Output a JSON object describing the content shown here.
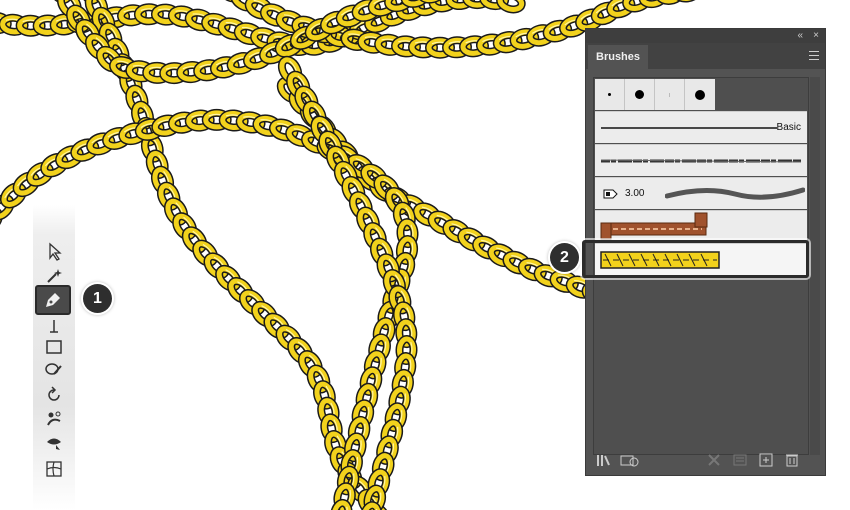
{
  "panel": {
    "tab_label": "Brushes",
    "collapse_glyph": "«",
    "close_glyph": "×",
    "brushes": [
      {
        "kind": "calligraphic-dots",
        "dots": [
          "small",
          "large",
          "tiny",
          "large"
        ]
      },
      {
        "kind": "basic-line",
        "label": "Basic"
      },
      {
        "kind": "charcoal-line",
        "label": ""
      },
      {
        "kind": "width-profile",
        "label": "3.00"
      },
      {
        "kind": "pattern-brown-chain",
        "label": ""
      },
      {
        "kind": "pattern-gold-chain",
        "label": "",
        "selected": true
      }
    ]
  },
  "callouts": {
    "first": "1",
    "second": "2"
  },
  "colors": {
    "chain_fill": "#f2d21c",
    "chain_stroke": "#1a1a1a",
    "panel_bg": "#535353",
    "brown_pattern": "#a0522d"
  },
  "tools": [
    "selection-tool",
    "magic-wand-tool",
    "pen-tool",
    "line-segment-tool",
    "rectangle-tool",
    "paintbrush-tool",
    "rotate-tool",
    "puppet-warp-tool",
    "free-transform-tool",
    "mesh-tool"
  ],
  "bottom_icons": [
    "brush-libraries-icon",
    "brush-library-menu-icon",
    "remove-stroke-icon",
    "brush-options-icon",
    "new-brush-icon",
    "delete-brush-icon"
  ]
}
